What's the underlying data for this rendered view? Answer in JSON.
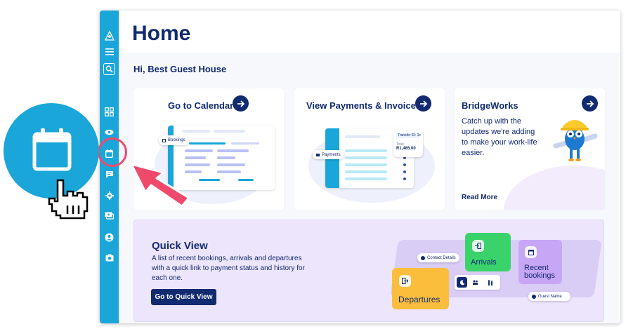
{
  "page": {
    "title": "Home",
    "greeting": "Hi, Best Guest House"
  },
  "sidebar": {
    "items": [
      "logo-icon",
      "menu-icon",
      "search-icon",
      "dashboard-icon",
      "eye-icon",
      "calendar-icon",
      "messages-icon",
      "settings-icon",
      "payments-icon",
      "account-icon",
      "camera-icon"
    ],
    "highlighted": "calendar-icon"
  },
  "cards": {
    "calendar": {
      "title": "Go to Calendar",
      "chip": "Bookings"
    },
    "payments": {
      "title": "View Payments & Invoices",
      "chip": "Payments",
      "transfer": "Transfer ID: 1c",
      "total_label": "Total",
      "total_value": "R1,485.00"
    },
    "bridgeworks": {
      "title": "BridgeWorks",
      "text": "Catch up with the updates we're adding to make your work-life easier.",
      "link": "Read More"
    }
  },
  "quick_view": {
    "title": "Quick View",
    "description": "A list of recent bookings, arrivals and departures with a quick link to payment status and history for each one.",
    "button": "Go to Quick View",
    "illustration": {
      "contact": "Contact Details",
      "arrivals": "Arrivals",
      "recent": "Recent bookings",
      "departures": "Departures",
      "guest": "Guest Name"
    }
  },
  "colors": {
    "navy": "#122a70",
    "sidebar": "#1aa6d9",
    "highlight": "#ef4a6b",
    "quick_bg": "#ece5fb",
    "arrivals": "#3ad36b",
    "departures": "#fbbe3c",
    "recent": "#c7a6f5"
  }
}
